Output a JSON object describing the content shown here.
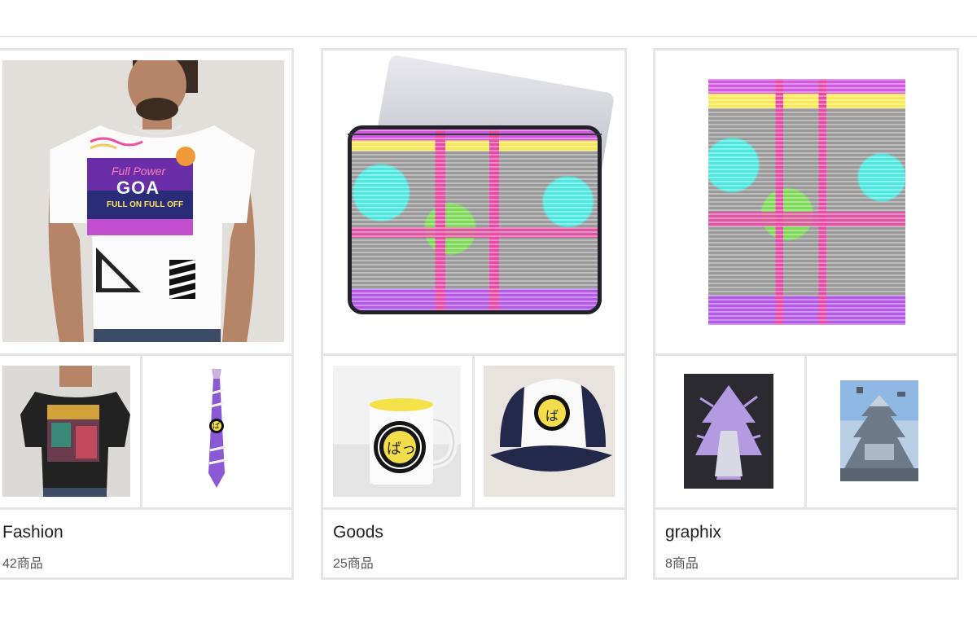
{
  "collections": [
    {
      "title": "Fashion",
      "count": "42商品",
      "hero": {
        "product": "t-shirt",
        "print_text": [
          "Full Power",
          "GOA",
          "FULL ON FULL OFF"
        ]
      },
      "thumbs": [
        {
          "product": "black-t-shirt"
        },
        {
          "product": "necktie",
          "print_text": "ば"
        }
      ]
    },
    {
      "title": "Goods",
      "count": "25商品",
      "hero": {
        "product": "laptop-sleeve"
      },
      "thumbs": [
        {
          "product": "mug",
          "print_text": "ばっ"
        },
        {
          "product": "trucker-cap",
          "print_text": "ば"
        }
      ]
    },
    {
      "title": "graphix",
      "count": "8商品",
      "hero": {
        "product": "poster"
      },
      "thumbs": [
        {
          "product": "dark-poster"
        },
        {
          "product": "castle-photo-print"
        }
      ]
    }
  ],
  "colors": {
    "card_border": "#e5e5e5",
    "title_text": "#222222",
    "count_text": "#555555",
    "glitch_pink": "#e84aa6",
    "glitch_cyan": "#4ee8e0",
    "glitch_yellow": "#f7e85a",
    "glitch_green": "#7ed957",
    "cap_navy": "#23294a"
  }
}
